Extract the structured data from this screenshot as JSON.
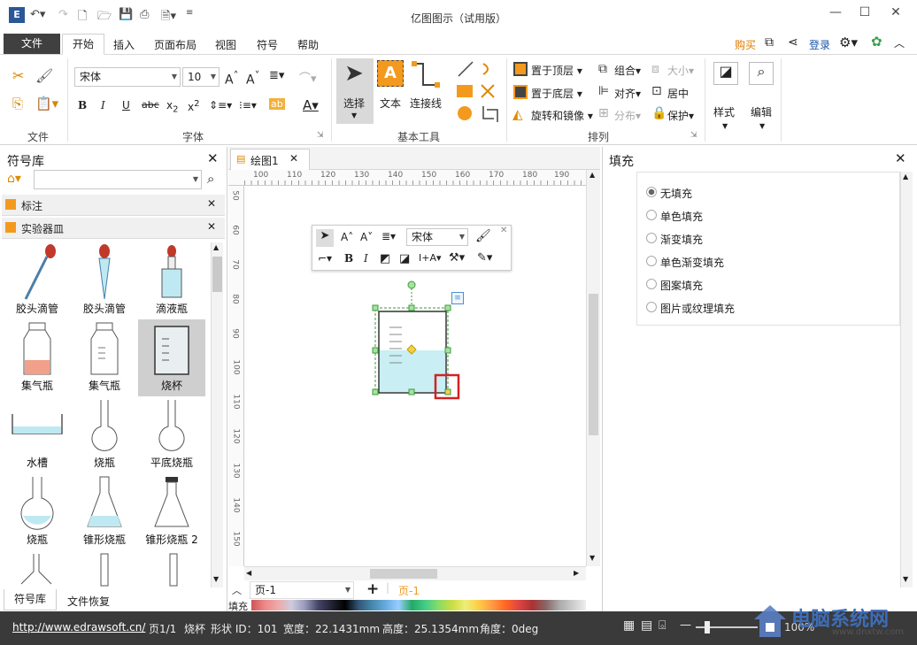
{
  "app": {
    "title": "亿图图示（试用版）"
  },
  "menubar": {
    "file": "文件",
    "tabs": [
      "开始",
      "插入",
      "页面布局",
      "视图",
      "符号",
      "帮助"
    ],
    "buy": "购买",
    "login": "登录"
  },
  "ribbon": {
    "font_name": "宋体",
    "font_size": "10",
    "groups": {
      "file": "文件",
      "font": "字体",
      "basic_tools": "基本工具",
      "arrange": "排列"
    },
    "tools": {
      "select": "选择",
      "text": "文本",
      "connector": "连接线"
    },
    "arrange": {
      "bring_front": "置于顶层",
      "send_back": "置于底层",
      "rotate_mirror": "旋转和镜像",
      "group": "组合",
      "align": "对齐",
      "distribute": "分布",
      "size": "大小",
      "center": "居中",
      "protect": "保护"
    },
    "style": "样式",
    "edit": "编辑"
  },
  "library": {
    "title": "符号库",
    "search_value": "",
    "categories": [
      "标注",
      "实验器皿"
    ],
    "shapes": [
      "胶头滴管",
      "胶头滴管",
      "滴液瓶",
      "集气瓶",
      "集气瓶",
      "烧杯",
      "水槽",
      "烧瓶",
      "平底烧瓶",
      "烧瓶",
      "锥形烧瓶",
      "锥形烧瓶 2"
    ],
    "bottom_tabs": [
      "符号库",
      "文件恢复"
    ]
  },
  "document": {
    "tab": "绘图1",
    "ruler_top": [
      "100",
      "110",
      "120",
      "130",
      "140",
      "150",
      "160",
      "170",
      "180",
      "190"
    ],
    "ruler_left": [
      "50",
      "60",
      "70",
      "80",
      "90",
      "100",
      "110",
      "120",
      "130",
      "140",
      "150"
    ],
    "float_font": "宋体",
    "page_name": "页-1",
    "page_tab": "页-1",
    "fill_label": "填充"
  },
  "fill_panel": {
    "title": "填充",
    "options": [
      "无填充",
      "单色填充",
      "渐变填充",
      "单色渐变填充",
      "图案填充",
      "图片或纹理填充"
    ],
    "selected": 0
  },
  "status": {
    "url": "http://www.edrawsoft.cn/",
    "page": "页1/1",
    "shape_name": "烧杯",
    "shape_id": "形状 ID：101",
    "width": "宽度：22.1431mm",
    "height": "高度：25.1354mm",
    "angle": "角度：0deg",
    "zoom": "100%"
  },
  "watermark": {
    "text": "电脑系统网",
    "url": "www.dnxtw.com"
  },
  "colors": {
    "accent_orange": "#f39a1e",
    "fill_cyan": "#c9eef4",
    "selection_green": "#3b9b3b",
    "highlight_red": "#d32222"
  }
}
